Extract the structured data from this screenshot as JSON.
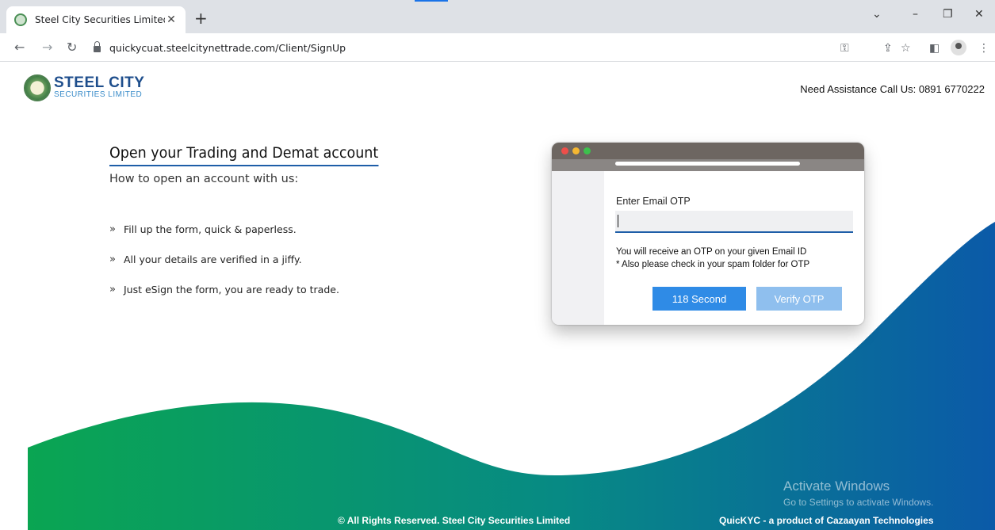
{
  "browser": {
    "tab_title": "Steel City Securities Limited",
    "url": "quickycuat.steelcitynettrade.com/Client/SignUp",
    "icons": [
      "back-icon",
      "forward-icon",
      "reload-icon",
      "lock-icon",
      "key-icon",
      "share-icon",
      "star-icon",
      "sidepanel-icon",
      "profile-icon",
      "menu-icon"
    ]
  },
  "header": {
    "logo_main": "STEEL CITY",
    "logo_sub": "SECURITIES LIMITED",
    "assistance": "Need Assistance Call Us: 0891 6770222"
  },
  "intro": {
    "title": "Open your Trading and Demat account",
    "subtitle": "How to open an account with us:",
    "steps": [
      "Fill up the form, quick & paperless.",
      "All your details are verified in a jiffy.",
      "Just eSign the form, you are ready to trade."
    ]
  },
  "otp_card": {
    "label": "Enter Email OTP",
    "input_value": "",
    "note_line1": "You will receive an OTP on your given Email ID",
    "note_line2": "* Also please check in your spam folder for OTP",
    "timer_button": "118 Second",
    "verify_button": "Verify OTP"
  },
  "footer": {
    "copyright": "© All Rights Reserved. Steel City Securities Limited",
    "product": "QuicKYC - a product of Cazaayan Technologies"
  },
  "watermark": {
    "line1": "Activate Windows",
    "line2": "Go to Settings to activate Windows."
  },
  "colors": {
    "brand_blue": "#1e4e8c",
    "accent_blue": "#2f8be6",
    "wave_green": "#0aa552",
    "wave_blue": "#0b5aa8"
  }
}
